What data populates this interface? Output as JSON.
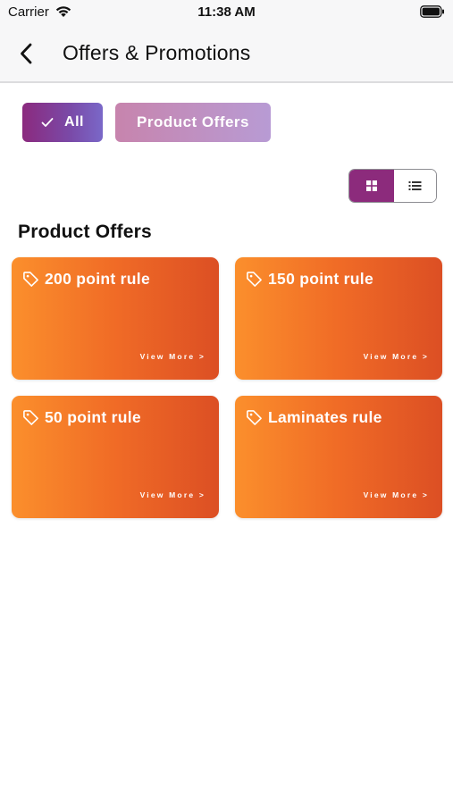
{
  "status_bar": {
    "carrier": "Carrier",
    "time": "11:38 AM"
  },
  "nav": {
    "title": "Offers & Promotions",
    "back_icon": "chevron-left-icon"
  },
  "filters": {
    "all_label": "All",
    "all_selected": true,
    "product_offers_label": "Product Offers"
  },
  "view_toggle": {
    "selected": "grid",
    "options": [
      "grid",
      "list"
    ]
  },
  "section": {
    "heading": "Product Offers"
  },
  "offers": [
    {
      "title": "200 point rule",
      "link_label": "View More >"
    },
    {
      "title": "150 point rule",
      "link_label": "View More >"
    },
    {
      "title": "50 point rule",
      "link_label": "View More >"
    },
    {
      "title": "Laminates rule",
      "link_label": "View More >"
    }
  ],
  "colors": {
    "accent_purple": "#8c2b7c",
    "card_gradient_start": "#fb8f2c",
    "card_gradient_end": "#dc4f24"
  }
}
